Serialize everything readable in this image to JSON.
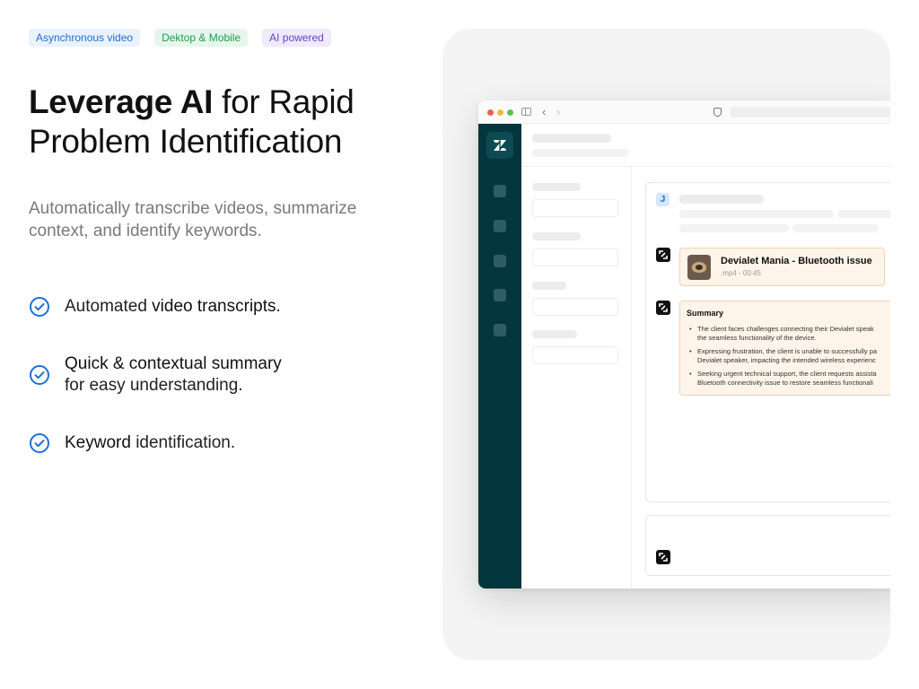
{
  "tags": [
    {
      "label": "Asynchronous video",
      "color": "#1e6fd9"
    },
    {
      "label": "Dektop & Mobile",
      "color": "#1f9d55"
    },
    {
      "label": "AI powered",
      "color": "#6941c6"
    }
  ],
  "headline": {
    "bold": "Leverage AI",
    "line1_rest": " for Rapid",
    "line2": "Problem Identification"
  },
  "subtitle": {
    "line1": "Automatically transcribe videos, summarize",
    "line2": "context, and identify keywords."
  },
  "features": [
    {
      "icon": "check-circle-icon",
      "lead": "Automated ",
      "strong": "video transcripts.",
      "rest": ""
    },
    {
      "icon": "check-circle-icon",
      "strong": "Quick & contextual summary",
      "line2": "for easy understanding."
    },
    {
      "icon": "check-circle-icon",
      "strong": "Keyword",
      "rest": " identification."
    }
  ],
  "accent_color": "#1e6fd9",
  "app": {
    "rail_color": "#03363d",
    "logo_icon": "zendesk-logo-icon",
    "avatar_letter": "J",
    "video": {
      "title": "Devialet Mania - Bluetooth issue",
      "meta": ".mp4 - 00:45"
    },
    "summary": {
      "title": "Summary",
      "items": [
        {
          "line1": "The client faces challenges connecting their Devialet speak",
          "line2": "the seamless functionality of the device."
        },
        {
          "line1": "Expressing frustration, the client is unable to successfully pa",
          "line2": "Devialet speaker, impacting the intended wireless experienc"
        },
        {
          "line1": "Seeking urgent technical support, the client requests assista",
          "line2": "Bluetooth connectivity issue to restore seamless functionali"
        }
      ]
    }
  }
}
